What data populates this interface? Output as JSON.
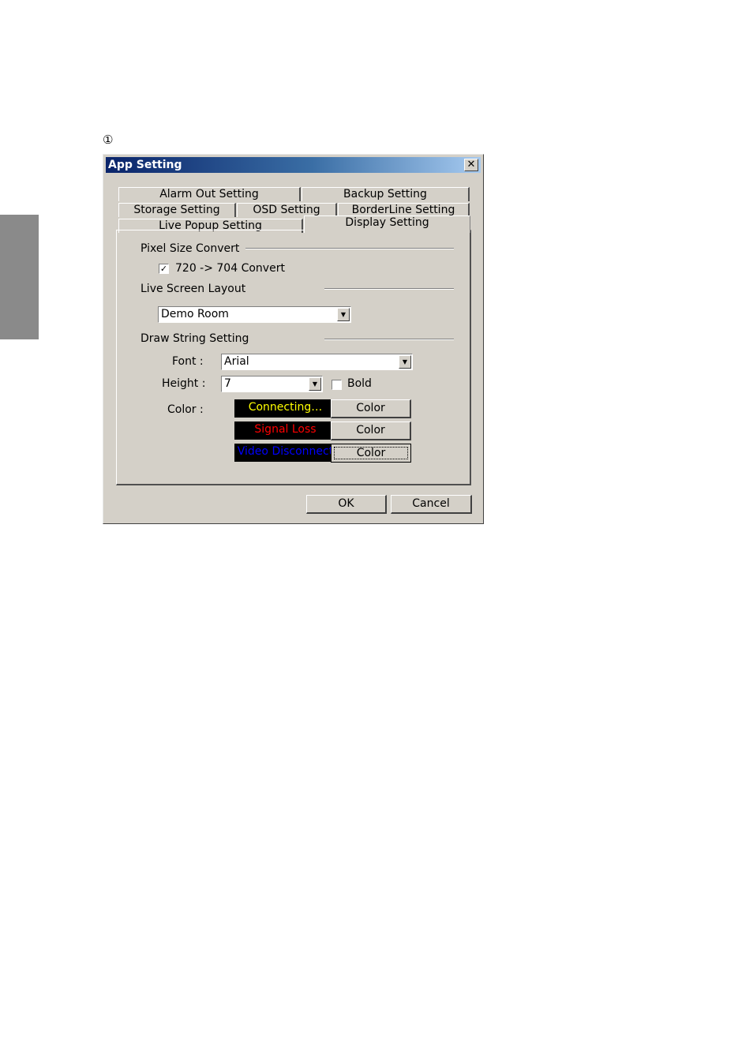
{
  "page": {
    "step_marker": "①"
  },
  "dialog": {
    "title": "App Setting",
    "close_glyph": "✕",
    "tabs": [
      {
        "label": "Alarm Out Setting"
      },
      {
        "label": "Backup Setting"
      },
      {
        "label": "Storage Setting"
      },
      {
        "label": "OSD Setting"
      },
      {
        "label": "BorderLine Setting"
      },
      {
        "label": "Live Popup Setting"
      },
      {
        "label": "Display Setting",
        "active": true
      }
    ],
    "pixel_size_convert": {
      "title": "Pixel Size Convert",
      "checkbox_label": "720 -> 704 Convert",
      "checked": true,
      "check_glyph": "✓"
    },
    "live_screen_layout": {
      "title": "Live Screen Layout",
      "selected": "Demo Room"
    },
    "draw_string": {
      "title": "Draw String Setting",
      "font_label": "Font :",
      "font_value": "Arial",
      "height_label": "Height :",
      "height_value": "7",
      "bold_label": "Bold",
      "bold_checked": false,
      "color_label": "Color :",
      "color_button_label": "Color",
      "swatches": [
        {
          "text": "Connecting…",
          "color": "#ffff00"
        },
        {
          "text": "Signal Loss",
          "color": "#ff0000"
        },
        {
          "text": "Video Disconnect",
          "color": "#0000ff"
        }
      ]
    },
    "buttons": {
      "ok": "OK",
      "cancel": "Cancel"
    },
    "colors": {
      "titlebar_start": "#0a246a",
      "titlebar_end": "#a6caf0",
      "face": "#d4d0c8"
    },
    "icons": {
      "dropdown": "▼",
      "close": "close-icon"
    }
  }
}
